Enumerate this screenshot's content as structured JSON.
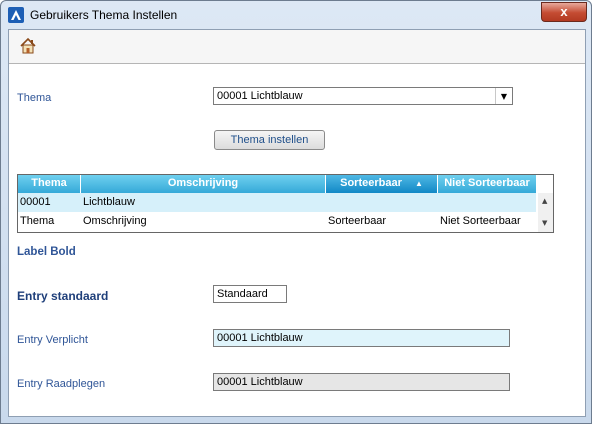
{
  "window": {
    "title": "Gebruikers Thema Instellen",
    "close_label": "x"
  },
  "toolbar": {
    "home_icon": "home-icon"
  },
  "form": {
    "thema_label": "Thema",
    "thema_value": "00001 Lichtblauw",
    "apply_button": "Thema instellen",
    "label_bold": "Label Bold",
    "entry_standaard_label": "Entry standaard",
    "entry_standaard_value": "Standaard",
    "entry_verplicht_label": "Entry Verplicht",
    "entry_verplicht_value": "00001 Lichtblauw",
    "entry_raadplegen_label": "Entry Raadplegen",
    "entry_raadplegen_value": "00001 Lichtblauw"
  },
  "grid": {
    "columns": [
      "Thema",
      "Omschrijving",
      "Sorteerbaar",
      "Niet Sorteerbaar"
    ],
    "sort_indicator": "▲",
    "rows": [
      [
        "00001",
        "Lichtblauw",
        "",
        ""
      ],
      [
        "Thema",
        "Omschrijving",
        "Sorteerbaar",
        "Niet Sorteerbaar"
      ]
    ]
  },
  "colors": {
    "label_blue": "#2f5597",
    "header_cyan": "#35a9d8",
    "selected_row": "#d6f0fa",
    "required_field": "#dff4fb",
    "readonly_field": "#e6e6e6"
  }
}
